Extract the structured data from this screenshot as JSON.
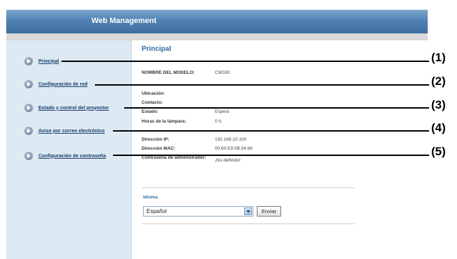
{
  "header": {
    "title": "Web Management"
  },
  "sidebar": {
    "items": [
      {
        "label": "Principal"
      },
      {
        "label": "Configuración de red"
      },
      {
        "label": "Estado y control del proyector"
      },
      {
        "label": "Aviso por correo electrónico"
      },
      {
        "label": "Configuración de contraseña"
      }
    ]
  },
  "main": {
    "title": "Principal",
    "info": [
      {
        "key": "NOMBRE DEL MODELO:",
        "value": "CW330"
      },
      {
        "key": "Ubicación:",
        "value": ""
      },
      {
        "key": "Contacto:",
        "value": ""
      },
      {
        "key": "Estado:",
        "value": "Espera"
      },
      {
        "key": "Horas de la lámpara:",
        "value": "0 h."
      },
      {
        "key": "Dirección IP:",
        "value": "192.168.10.100"
      },
      {
        "key": "Dirección MAC:",
        "value": "00:60:E9:0B:54:66"
      },
      {
        "key": "Contraseña de administrador:",
        "value": "¡No definido!"
      }
    ],
    "language": {
      "label": "Idioma",
      "selected": "Español",
      "submit_label": "Enviar"
    }
  },
  "callouts": [
    "(1)",
    "(2)",
    "(3)",
    "(4)",
    "(5)"
  ]
}
